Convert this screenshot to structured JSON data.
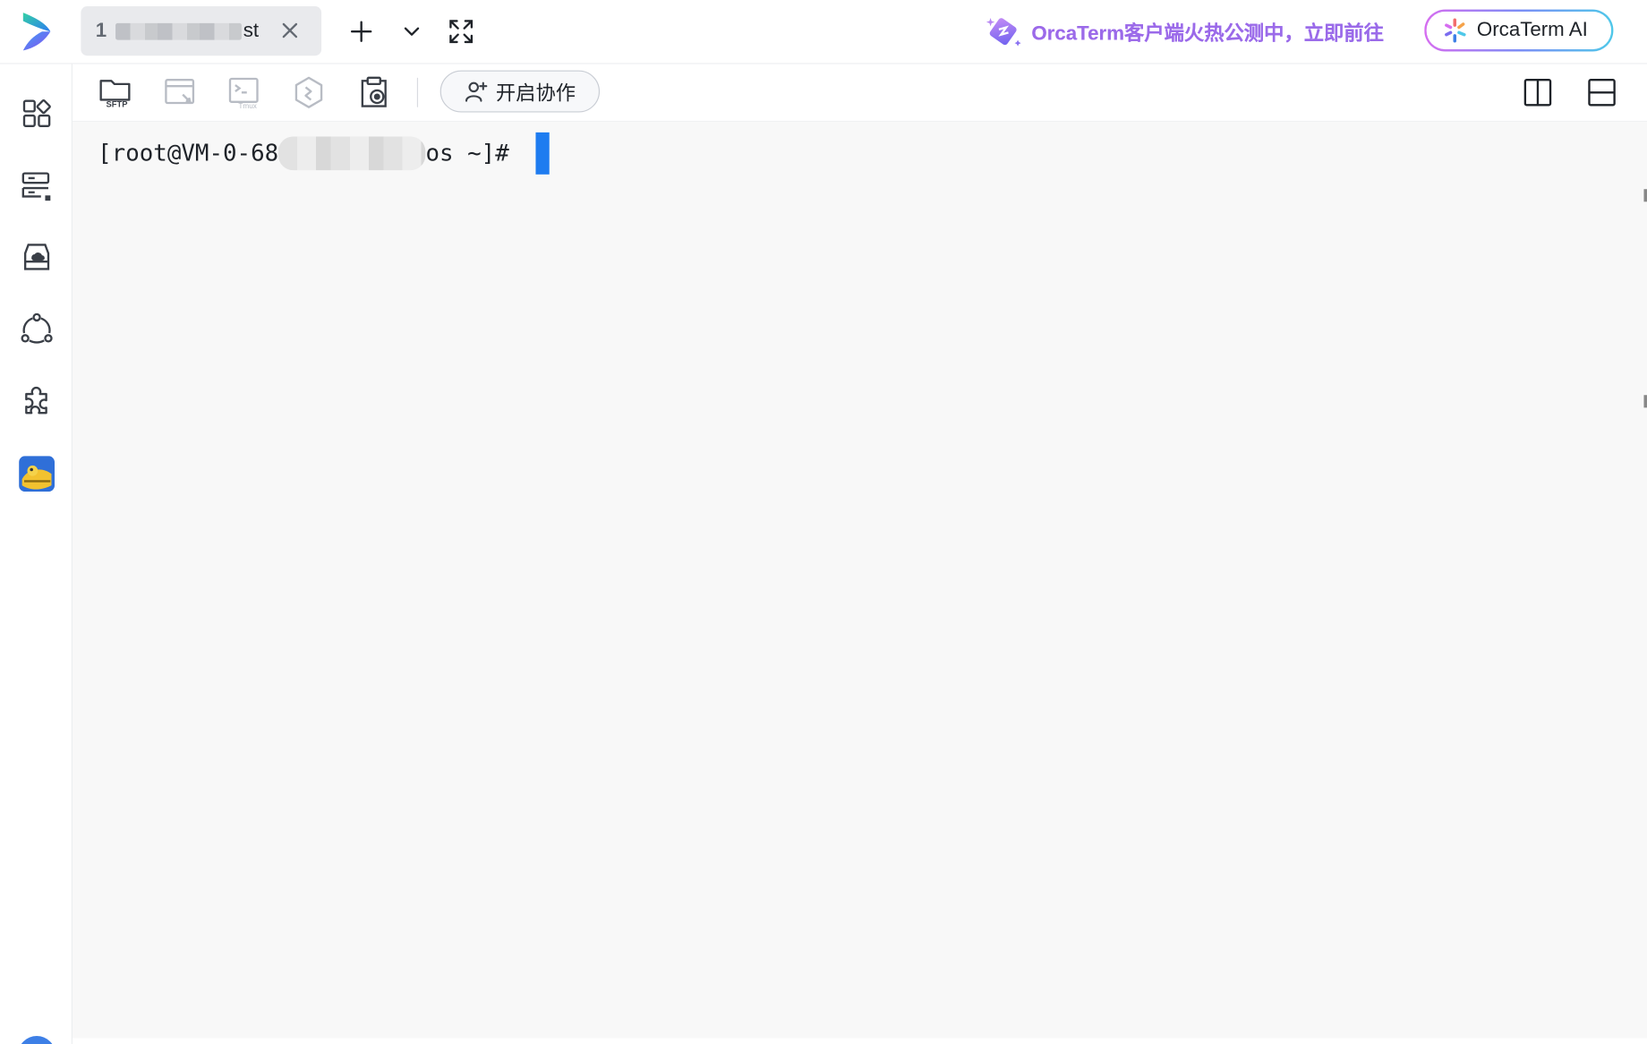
{
  "tab": {
    "index": "1",
    "title_suffix": "st"
  },
  "topbar_icons": [
    "add-icon",
    "chevron-down-icon",
    "fullscreen-icon"
  ],
  "promo": {
    "text": "OrcaTerm客户端火热公测中，立即前往",
    "color": "#9b6ae9"
  },
  "ai_button": {
    "label": "OrcaTerm AI"
  },
  "sidebar": {
    "items": [
      {
        "icon": "apps-icon"
      },
      {
        "icon": "server-list-icon"
      },
      {
        "icon": "cloud-drive-icon"
      },
      {
        "icon": "network-icon"
      },
      {
        "icon": "plugin-icon"
      },
      {
        "icon": "user-avatar-icon"
      }
    ]
  },
  "toolbar": {
    "sftp_label": "SFTP",
    "tmux_label": "Tmux",
    "collab_label": "开启协作",
    "tools": [
      "sftp-icon",
      "remote-desktop-icon",
      "tmux-icon",
      "settings-hex-icon",
      "screen-record-icon"
    ],
    "right_icons": [
      "split-vertical-icon",
      "split-horizontal-icon"
    ]
  },
  "terminal": {
    "prompt_prefix": "[root@VM-0-68",
    "prompt_suffix": "os ~]# ",
    "cursor_color": "#1e7cf0",
    "background": "#f8f8f8"
  }
}
